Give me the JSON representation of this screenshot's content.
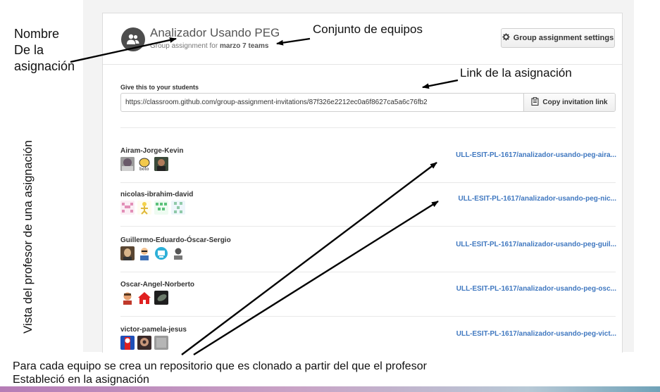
{
  "assignment": {
    "title": "Analizador Usando PEG",
    "subtitle_prefix": "Group assignment for",
    "subtitle_set": "marzo 7 teams",
    "settings_label": "Group assignment settings",
    "give_label": "Give this to your students",
    "invite_url": "https://classroom.github.com/group-assignment-invitations/87f326e2212ec0a6f8627ca5a6c76fb2",
    "copy_label": "Copy invitation link"
  },
  "teams": [
    {
      "name": "Airam-Jorge-Kevin",
      "repo": "ULL-ESIT-PL-1617/analizador-usando-peg-aira..."
    },
    {
      "name": "nicolas-ibrahim-david",
      "repo": "ULL-ESIT-PL-1617/analizador-usando-peg-nic..."
    },
    {
      "name": "Guillermo-Eduardo-Óscar-Sergio",
      "repo": "ULL-ESIT-PL-1617/analizador-usando-peg-guil..."
    },
    {
      "name": "Oscar-Angel-Norberto",
      "repo": "ULL-ESIT-PL-1617/analizador-usando-peg-osc..."
    },
    {
      "name": "victor-pamela-jesus",
      "repo": "ULL-ESIT-PL-1617/analizador-usando-peg-vict..."
    }
  ],
  "annotations": {
    "nombre_1": "Nombre",
    "nombre_2": "De la",
    "nombre_3": "asignación",
    "conjunto": "Conjunto de equipos",
    "link": "Link de la asignación",
    "vertical": "Vista del profesor de una asignación",
    "caption_1": "Para cada equipo se crea un repositorio que es clonado a partir del que el profesor",
    "caption_2": "Estableció en la asignación"
  },
  "icons": {
    "group": "people-icon",
    "settings": "gear-icon",
    "copy": "clipboard-icon"
  },
  "colors": {
    "link": "#4078c0",
    "panel": "#f3f3f3",
    "avatar_bg": "#4d4d4d"
  }
}
